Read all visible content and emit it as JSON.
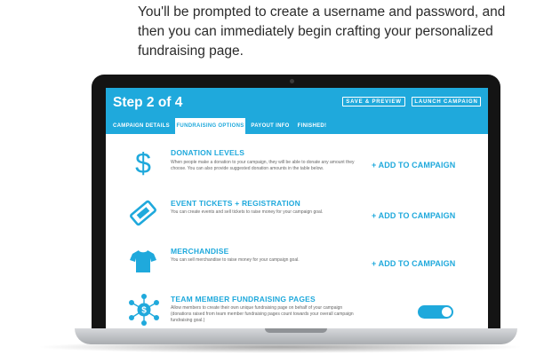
{
  "intro": {
    "text": "You'll be prompted to create a username and password, and then you can immediately begin crafting your personalized fundraising page."
  },
  "app": {
    "step_title": "Step 2 of 4",
    "header_buttons": {
      "save_preview": "SAVE & PREVIEW",
      "launch_campaign": "LAUNCH CAMPAIGN"
    },
    "tabs": [
      {
        "label": "CAMPAIGN DETAILS",
        "active": false
      },
      {
        "label": "FUNDRAISING OPTIONS",
        "active": true
      },
      {
        "label": "PAYOUT INFO",
        "active": false
      },
      {
        "label": "FINISHED!",
        "active": false
      }
    ],
    "options": [
      {
        "title": "DONATION LEVELS",
        "description": "When people make a donation to your campaign, they will be able to donate any amount they choose. You can also provide suggested donation amounts in the table below.",
        "action": "+ ADD TO CAMPAIGN",
        "icon": "dollar-sign-icon"
      },
      {
        "title": "EVENT TICKETS + REGISTRATION",
        "description": "You can create events and sell tickets to raise money for your campaign goal.",
        "action": "+ ADD TO CAMPAIGN",
        "icon": "ticket-icon"
      },
      {
        "title": "MERCHANDISE",
        "description": "You can sell merchandise to raise money for your campaign goal.",
        "action": "+ ADD TO CAMPAIGN",
        "icon": "tshirt-icon"
      },
      {
        "title": "TEAM MEMBER FUNDRAISING PAGES",
        "description": "Allow members to create their own unique fundraising page on behalf of your campaign (donations raised from team member fundraising pages count towards your overall campaign fundraising goal.)",
        "toggle_on": true,
        "icon": "team-network-icon"
      }
    ],
    "colors": {
      "accent": "#1fa9dc",
      "bezel": "#141414"
    }
  }
}
